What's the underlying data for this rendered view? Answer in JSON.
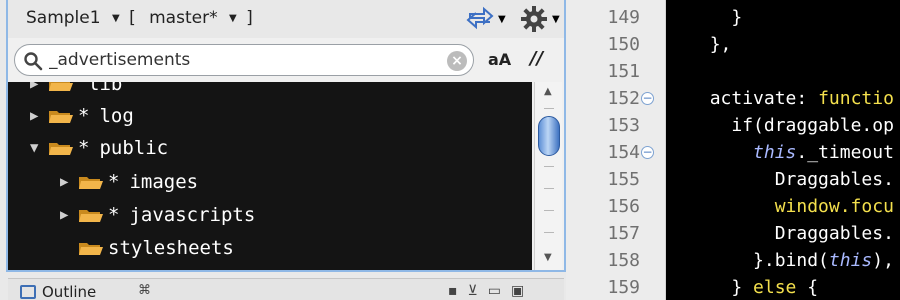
{
  "toolbar": {
    "project": "Sample1",
    "branch_open": "[",
    "branch": "master*",
    "branch_close": "]"
  },
  "search": {
    "value": "_advertisements",
    "case_label": "aA",
    "regex_label": "//"
  },
  "tree": {
    "items": [
      {
        "label": "lib",
        "star": "",
        "expanded": false,
        "indent": 1
      },
      {
        "label": "log",
        "star": "*",
        "expanded": false,
        "indent": 1
      },
      {
        "label": "public",
        "star": "*",
        "expanded": true,
        "indent": 1
      },
      {
        "label": "images",
        "star": "*",
        "expanded": false,
        "indent": 2
      },
      {
        "label": "javascripts",
        "star": "*",
        "expanded": false,
        "indent": 2
      },
      {
        "label": "stylesheets",
        "star": "",
        "expanded": false,
        "indent": 2
      }
    ]
  },
  "outline": {
    "label": "Outline",
    "close": "⌘"
  },
  "editor": {
    "line_numbers": [
      "149",
      "150",
      "151",
      "152",
      "153",
      "154",
      "155",
      "156",
      "157",
      "158",
      "159"
    ],
    "folded_lines": [
      "152",
      "154"
    ],
    "code": [
      {
        "indent": "    ",
        "plain": "}",
        "em": "",
        "tail": ""
      },
      {
        "indent": "  ",
        "plain": "},",
        "em": "",
        "tail": ""
      },
      {
        "indent": "",
        "plain": "",
        "em": "",
        "tail": ""
      },
      {
        "indent": "  ",
        "plain": "activate: ",
        "kw": "functio",
        "em": "",
        "tail": ""
      },
      {
        "indent": "    ",
        "plain": "if(draggable.op",
        "em": "",
        "tail": ""
      },
      {
        "indent": "      ",
        "plain": "",
        "em": "this",
        "tail": "._timeout"
      },
      {
        "indent": "        ",
        "plain": "Draggables.",
        "em": "",
        "tail": ""
      },
      {
        "indent": "        ",
        "plain": "window.focu",
        "em": "",
        "tail": "",
        "yellow": true
      },
      {
        "indent": "        ",
        "plain": "Draggables.",
        "em": "",
        "tail": ""
      },
      {
        "indent": "      ",
        "plain": "}.bind(",
        "em": "this",
        "tail": "),"
      },
      {
        "indent": "    ",
        "plain": "} ",
        "kw": "else",
        "tail": " {"
      }
    ]
  },
  "colors": {
    "tree_bg": "#141414",
    "code_keyword": "#f4e04d",
    "accent": "#3f73c2"
  }
}
